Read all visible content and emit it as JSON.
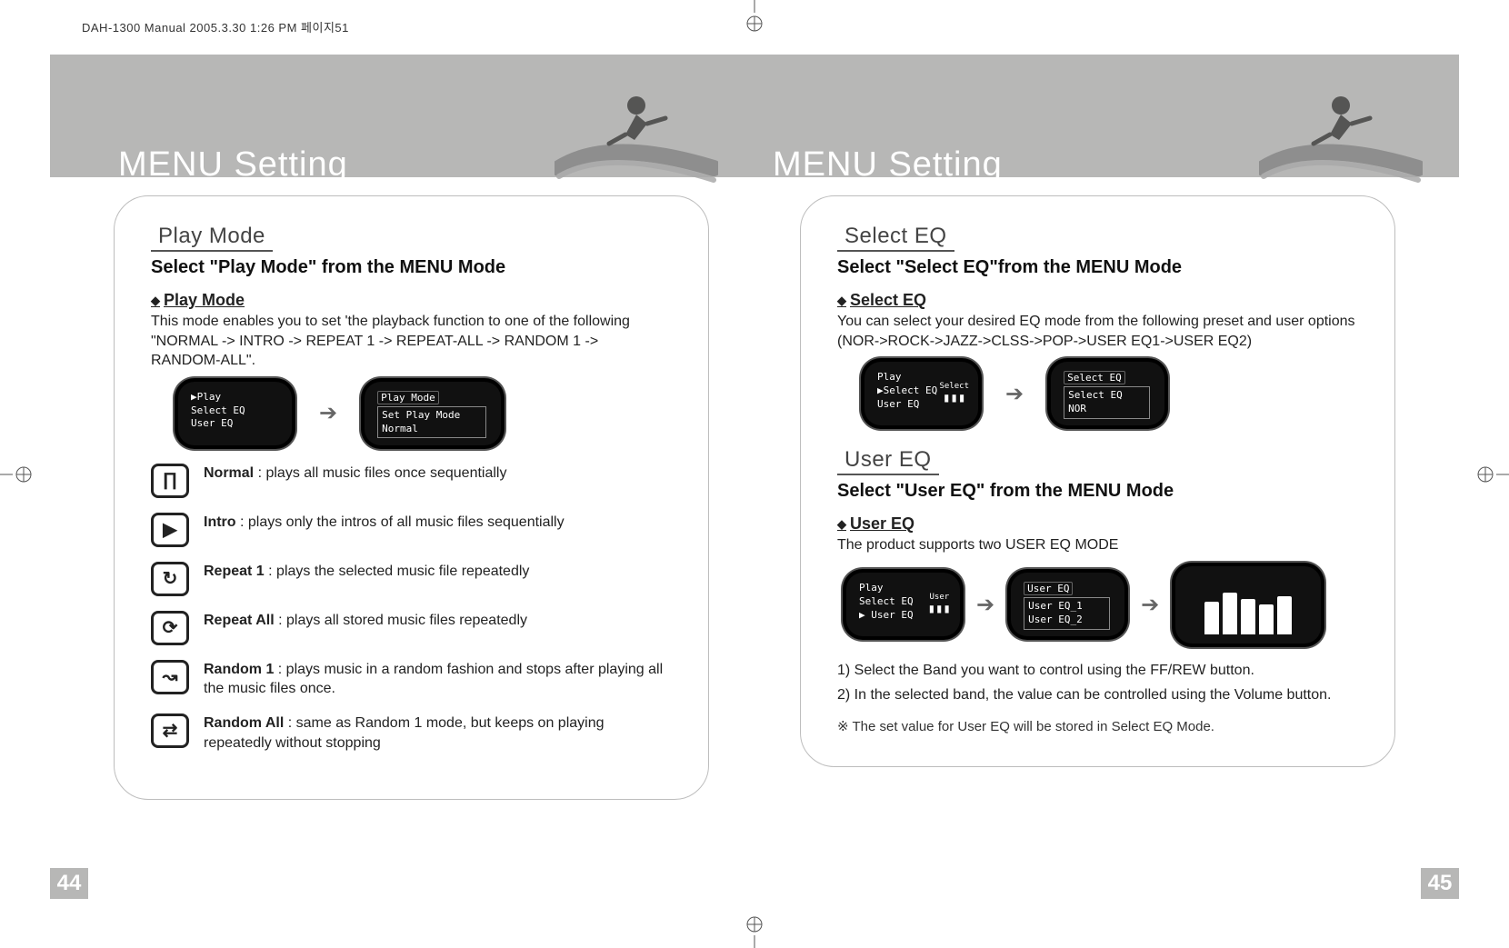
{
  "header_line": "DAH-1300 Manual  2005.3.30 1:26 PM  페이지51",
  "left": {
    "menu_title": "MENU Setting",
    "page_num": "44",
    "section1": {
      "title": "Play Mode",
      "subtitle": "Select \"Play Mode\" from the MENU Mode",
      "heading": "Play Mode",
      "body": "This mode enables you to set 'the playback function to one of the following \"NORMAL -> INTRO -> REPEAT 1 -> REPEAT-ALL -> RANDOM 1 -> RANDOM-ALL\".",
      "lcd1": {
        "line1": "▶Play",
        "line2": "Select EQ",
        "line3": "User EQ"
      },
      "lcd2": {
        "title": "Play Mode",
        "line1": "Set Play Mode",
        "line2": "Normal"
      },
      "modes": [
        {
          "icon": "∏",
          "label": "Normal",
          "desc": " : plays all music files once sequentially"
        },
        {
          "icon": "▶",
          "label": "Intro",
          "desc": " : plays only the intros of all music files sequentially"
        },
        {
          "icon": "↻",
          "label": "Repeat 1",
          "desc": " : plays the selected music file repeatedly"
        },
        {
          "icon": "⟳",
          "label": "Repeat All",
          "desc": " : plays all stored music files repeatedly"
        },
        {
          "icon": "↝",
          "label": "Random 1",
          "desc": " : plays music in a random fashion and stops after playing all the music files once."
        },
        {
          "icon": "⇄",
          "label": "Random All",
          "desc": " : same as Random 1 mode, but keeps on playing repeatedly without stopping"
        }
      ]
    }
  },
  "right": {
    "menu_title": "MENU Setting",
    "page_num": "45",
    "section1": {
      "title": "Select EQ",
      "subtitle": "Select \"Select EQ\"from the MENU Mode",
      "heading": "Select EQ",
      "body": "You can select your desired EQ mode from the following preset and user options (NOR->ROCK->JAZZ->CLSS->POP->USER EQ1->USER EQ2)",
      "lcd1": {
        "line1": "Play",
        "line2": "▶Select EQ",
        "line3": "User EQ",
        "badge": "Select"
      },
      "lcd2": {
        "title": "Select EQ",
        "line1": "Select EQ",
        "line2": "NOR"
      }
    },
    "section2": {
      "title": "User EQ",
      "subtitle": "Select \"User EQ\" from the MENU Mode",
      "heading": "User EQ",
      "body": "The product supports two USER EQ MODE",
      "lcd1": {
        "line1": "Play",
        "line2": "Select EQ",
        "line3": "▶ User EQ",
        "badge": "User"
      },
      "lcd2": {
        "title": "User EQ",
        "line1": "User EQ_1",
        "line2": "User EQ_2"
      },
      "step1": "1) Select the Band you want to control using the FF/REW button.",
      "step2": "2) In the selected band, the value can be controlled using the Volume button.",
      "note": "The set value for User EQ will be stored in Select EQ Mode."
    }
  }
}
